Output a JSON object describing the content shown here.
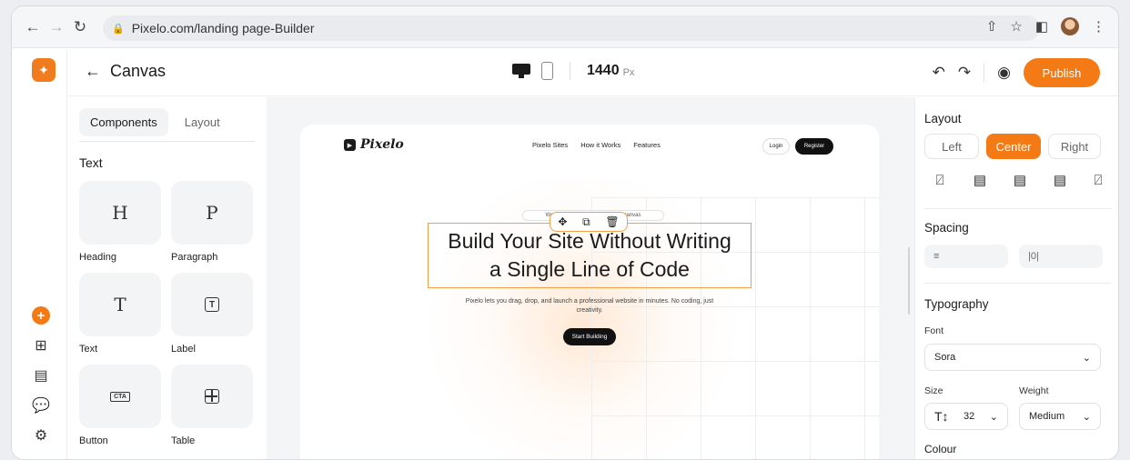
{
  "browser": {
    "url": "Pixelo.com/landing page-Builder"
  },
  "header": {
    "title": "Canvas",
    "canvas_width": "1440",
    "canvas_unit": "Px",
    "publish_label": "Publish"
  },
  "components_panel": {
    "tabs": [
      "Components",
      "Layout"
    ],
    "section_title": "Text",
    "items": [
      {
        "label": "Heading",
        "glyph": "H"
      },
      {
        "label": "Paragraph",
        "glyph": "P"
      },
      {
        "label": "Text",
        "glyph": "T"
      },
      {
        "label": "Label",
        "glyph": "T"
      },
      {
        "label": "Button",
        "glyph": "CTA"
      },
      {
        "label": "Table",
        "glyph": "table"
      }
    ]
  },
  "preview": {
    "logo": "Pixelo",
    "nav": [
      "Pixelo Sites",
      "How it Works",
      "Features"
    ],
    "login": "Login",
    "register": "Register",
    "badge": "Website Builder · Check out the canvas",
    "headline_line1": "Build Your Site Without Writing",
    "headline_line2": "a Single Line of Code",
    "subtext": "Pixelo lets you drag, drop, and launch a professional website in minutes. No coding, just creativity.",
    "cta": "Start Building"
  },
  "properties": {
    "layout_title": "Layout",
    "align_options": [
      "Left",
      "Center",
      "Right"
    ],
    "align_selected": "Center",
    "spacing_title": "Spacing",
    "typography_title": "Typography",
    "font_label": "Font",
    "font_value": "Sora",
    "size_label": "Size",
    "size_value": "32",
    "weight_label": "Weight",
    "weight_value": "Medium",
    "colour_label": "Colour"
  },
  "colors": {
    "accent": "#f47a16",
    "selection": "#f4a04a"
  }
}
